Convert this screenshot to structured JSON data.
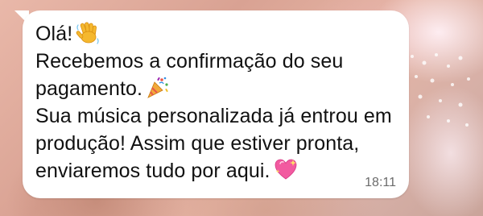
{
  "message": {
    "lines": [
      "Olá!",
      "Recebemos a confirmação do seu",
      "pagamento.",
      "Sua música personalizada já entrou em",
      "produção! Assim que estiver pronta,",
      "enviaremos tudo por aqui."
    ],
    "timestamp": "18:11"
  },
  "icons": {
    "line_1": "waving-hand",
    "line_3": "party-popper",
    "line_6": "sparkling-heart"
  },
  "colors": {
    "bubble": "#ffffff",
    "text": "#111111",
    "timestamp": "#6b6b6b"
  }
}
